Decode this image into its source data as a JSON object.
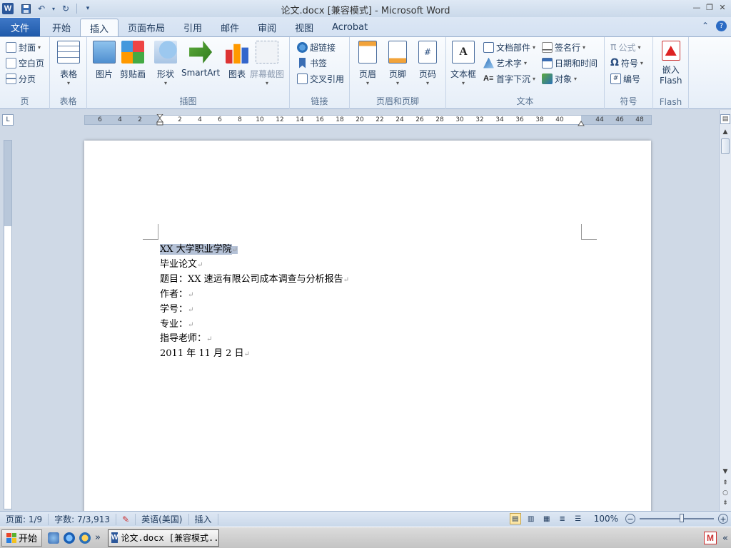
{
  "window": {
    "title": "论文.docx [兼容模式] - Microsoft Word",
    "logo": "W",
    "controls": [
      "—",
      "❐",
      "✕"
    ]
  },
  "tabs": {
    "file": "文件",
    "items": [
      "开始",
      "插入",
      "页面布局",
      "引用",
      "邮件",
      "审阅",
      "视图",
      "Acrobat"
    ],
    "active_index": 1
  },
  "ribbon": {
    "page_group": {
      "label": "页",
      "cover": "封面",
      "blank": "空白页",
      "break": "分页"
    },
    "table_group": {
      "label": "表格",
      "table": "表格"
    },
    "illustrations_group": {
      "label": "插图",
      "picture": "图片",
      "clipart": "剪贴画",
      "shapes": "形状",
      "smartart": "SmartArt",
      "chart": "图表",
      "screenshot": "屏幕截图"
    },
    "links_group": {
      "label": "链接",
      "hyperlink": "超链接",
      "bookmark": "书签",
      "crossref": "交叉引用"
    },
    "header_footer_group": {
      "label": "页眉和页脚",
      "header": "页眉",
      "footer": "页脚",
      "page_number": "页码"
    },
    "text_group": {
      "label": "文本",
      "textbox": "文本框",
      "quickparts": "文档部件",
      "wordart": "艺术字",
      "dropcap": "首字下沉",
      "signature": "签名行",
      "datetime": "日期和时间",
      "object": "对象"
    },
    "symbols_group": {
      "label": "符号",
      "equation": "公式",
      "symbol": "符号",
      "number": "编号"
    },
    "flash_group": {
      "label": "Flash",
      "embed": "嵌入",
      "flash": "Flash"
    }
  },
  "ruler": {
    "numbers": [
      "6",
      "4",
      "2",
      "2",
      "4",
      "6",
      "8",
      "10",
      "12",
      "14",
      "16",
      "18",
      "20",
      "22",
      "24",
      "26",
      "28",
      "30",
      "32",
      "34",
      "36",
      "38",
      "40",
      "44",
      "46",
      "48"
    ],
    "corner": "L"
  },
  "document": {
    "lines": [
      "XX 大学职业学院",
      "毕业论文",
      "题目：XX 速运有限公司成本调查与分析报告",
      "作者：",
      "学号：",
      "专业：",
      "指导老师：",
      "2011 年 11 月 2 日"
    ],
    "paragraph_mark": "↵"
  },
  "status": {
    "page": "页面: 1/9",
    "words": "字数: 7/3,913",
    "language": "英语(美国)",
    "mode": "插入",
    "zoom": "100%"
  },
  "taskbar": {
    "start": "开始",
    "chevron": "»",
    "item": "论文.docx [兼容模式...",
    "tray_chevron": "«"
  }
}
